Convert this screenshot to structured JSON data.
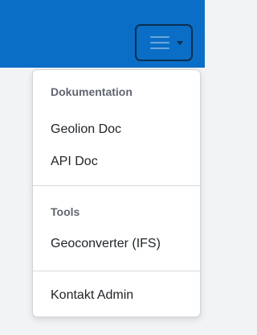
{
  "navbar": {
    "toggle_icon": "hamburger-icon",
    "caret_icon": "caret-down-icon",
    "colors": {
      "bar": "#0a6ec6",
      "toggle_border": "#0b2f50"
    }
  },
  "menu": {
    "sections": [
      {
        "header": "Dokumentation",
        "items": [
          "Geolion Doc",
          "API Doc"
        ]
      },
      {
        "header": "Tools",
        "items": [
          "Geoconverter (IFS)"
        ]
      }
    ],
    "footer_item": "Kontakt Admin"
  }
}
